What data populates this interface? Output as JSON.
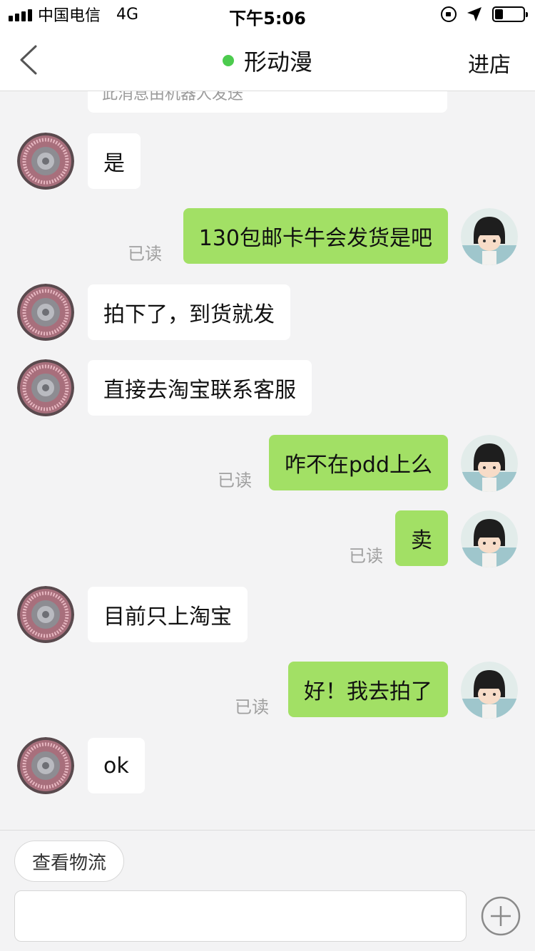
{
  "status_bar": {
    "carrier": "中国电信",
    "network": "4G",
    "time": "下午5:06",
    "battery_level": 0.3
  },
  "nav": {
    "title": "形动漫",
    "right_action": "进店"
  },
  "chat": {
    "system_text": "此消息由机器人发送",
    "read_label": "已读",
    "messages": [
      {
        "side": "in",
        "text": "是"
      },
      {
        "side": "out",
        "text": "130包邮卡牛会发货是吧",
        "read": true
      },
      {
        "side": "in",
        "text": "拍下了，到货就发"
      },
      {
        "side": "in",
        "text": "直接去淘宝联系客服"
      },
      {
        "side": "out",
        "text": "咋不在pdd上么",
        "read": true
      },
      {
        "side": "out",
        "text": "卖",
        "read": true
      },
      {
        "side": "in",
        "text": "目前只上淘宝"
      },
      {
        "side": "out",
        "text": "好！我去拍了",
        "read": true
      },
      {
        "side": "in",
        "text": "ok"
      }
    ]
  },
  "bottom": {
    "logistics_button": "查看物流",
    "input_value": ""
  },
  "colors": {
    "out_bubble": "#a2e065",
    "in_bubble": "#ffffff",
    "background": "#f3f3f4",
    "online_dot": "#4ccb4e"
  }
}
